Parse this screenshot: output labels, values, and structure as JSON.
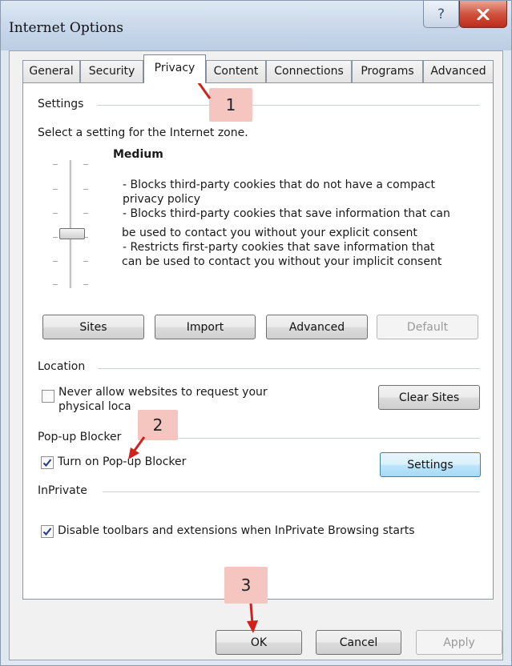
{
  "window": {
    "title": "Internet Options"
  },
  "tabs": [
    {
      "label": "General"
    },
    {
      "label": "Security"
    },
    {
      "label": "Privacy",
      "selected": true
    },
    {
      "label": "Content"
    },
    {
      "label": "Connections"
    },
    {
      "label": "Programs"
    },
    {
      "label": "Advanced"
    }
  ],
  "settings": {
    "group_label": "Settings",
    "instruction": "Select a setting for the Internet zone.",
    "level": "Medium",
    "description_lines": [
      "- Blocks third-party cookies that do not have a compact",
      "privacy policy",
      "- Blocks third-party cookies that save information that can",
      "be used to contact you without your explicit consent",
      "- Restricts first-party cookies that save information that",
      "can be used to contact you without your implicit consent"
    ],
    "buttons": {
      "sites": "Sites",
      "import": "Import",
      "advanced": "Advanced",
      "default": "Default"
    }
  },
  "location": {
    "group_label": "Location",
    "checkbox_line1": "Never allow websites to request your",
    "checkbox_line2": "physical loca",
    "checked": false,
    "clear_sites": "Clear Sites"
  },
  "popup": {
    "group_label": "Pop-up Blocker",
    "checkbox_label": "Turn on Pop-up Blocker",
    "checked": true,
    "settings_button": "Settings"
  },
  "inprivate": {
    "group_label": "InPrivate",
    "checkbox_label": "Disable toolbars and extensions when InPrivate Browsing starts",
    "checked": true
  },
  "footer": {
    "ok": "OK",
    "cancel": "Cancel",
    "apply": "Apply"
  },
  "annotations": [
    {
      "label": "1"
    },
    {
      "label": "2"
    },
    {
      "label": "3"
    }
  ],
  "colors": {
    "annotation_box": "#f5c6bf",
    "annotation_arrow": "#d0221a",
    "close_button": "#c9402c"
  }
}
